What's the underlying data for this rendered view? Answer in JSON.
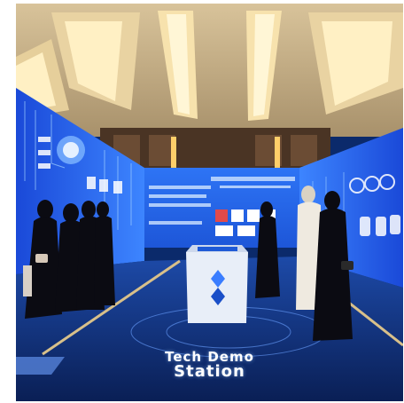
{
  "scene": {
    "floor_text_line1": "Tech Demo",
    "floor_text_line2": "Station"
  },
  "colors": {
    "ceiling": "#c9b38a",
    "ceiling_light": "#ffd98a",
    "wall_dark": "#3a2a1e",
    "screen_blue": "#1c57e0",
    "screen_glow": "#2f78ff",
    "floor": "#0e2a6e",
    "floor_line": "#d8c08a",
    "kiosk": "#e8eef8"
  }
}
